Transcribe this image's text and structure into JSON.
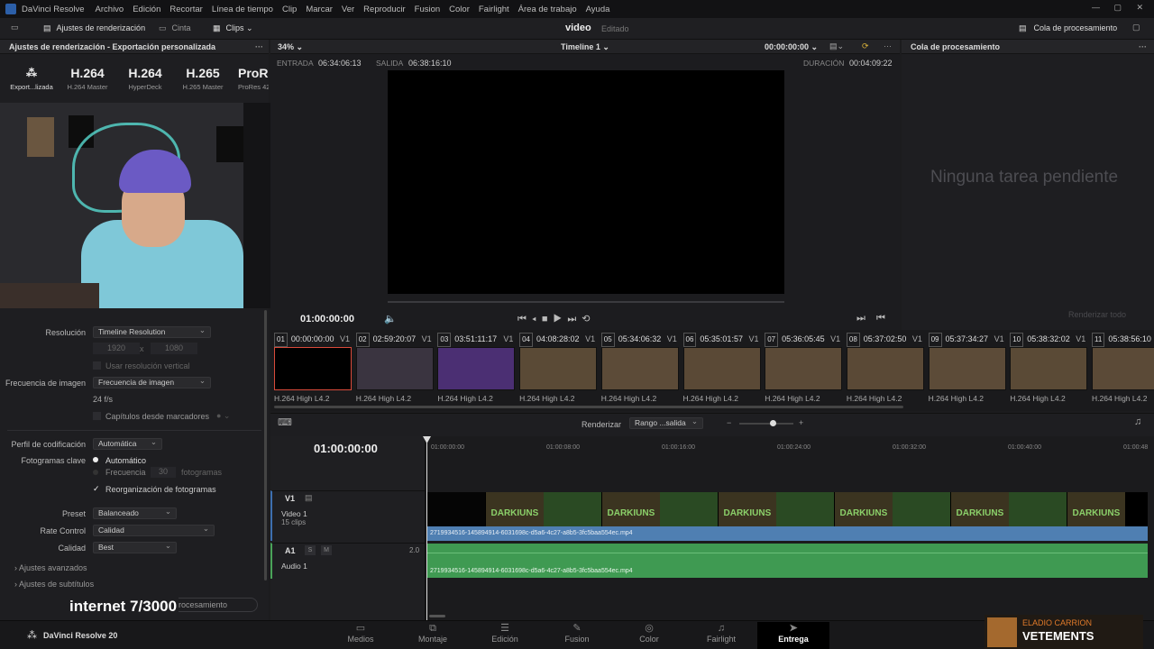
{
  "app": {
    "title": "DaVinci Resolve"
  },
  "menu": [
    "Archivo",
    "Edición",
    "Recortar",
    "Línea de tiempo",
    "Clip",
    "Marcar",
    "Ver",
    "Reproducir",
    "Fusion",
    "Color",
    "Fairlight",
    "Área de trabajo",
    "Ayuda"
  ],
  "toolbar": {
    "render_settings": "Ajustes de renderización",
    "tape": "Cinta",
    "clips": "Clips",
    "project": "video",
    "status": "Editado",
    "queue": "Cola de procesamiento"
  },
  "render_panel": {
    "title": "Ajustes de renderización - Exportación personalizada",
    "presets": [
      {
        "big": "",
        "label": "Export...lizada"
      },
      {
        "big": "H.264",
        "label": "H.264 Master"
      },
      {
        "big": "H.264",
        "label": "HyperDeck"
      },
      {
        "big": "H.265",
        "label": "H.265 Master"
      },
      {
        "big": "ProRe",
        "label": "ProRes 42"
      }
    ],
    "resolution_label": "Resolución",
    "resolution_value": "Timeline Resolution",
    "width": "1920",
    "x": "x",
    "height": "1080",
    "vertical": "Usar resolución vertical",
    "framerate_label": "Frecuencia de imagen",
    "framerate_value": "Frecuencia de imagen",
    "fps": "24 f/s",
    "chapters": "Capítulos desde marcadores",
    "profile_label": "Perfil de codificación",
    "profile_value": "Automática",
    "keyframes_label": "Fotogramas clave",
    "kf_auto": "Automático",
    "kf_freq": "Frecuencia",
    "kf_freq_val": "30",
    "kf_unit": "fotogramas",
    "reorder": "Reorganización de fotogramas",
    "preset_label": "Preset",
    "preset_value": "Balanceado",
    "ratecontrol_label": "Rate Control",
    "ratecontrol_value": "Calidad",
    "quality_label": "Calidad",
    "quality_value": "Best",
    "advanced": "Ajustes avanzados",
    "subtitles": "Ajustes de subtítulos",
    "add_queue": "Añadir a la cola de procesamiento"
  },
  "viewer": {
    "zoom": "34%",
    "timeline_name": "Timeline 1",
    "timecode_top": "00:00:00:00",
    "in_label": "ENTRADA",
    "in_tc": "06:34:06:13",
    "out_label": "SALIDA",
    "out_tc": "06:38:16:10",
    "dur_label": "DURACIÓN",
    "dur_tc": "00:04:09:22",
    "current_tc": "01:00:00:00"
  },
  "queue": {
    "title": "Cola de procesamiento",
    "empty": "Ninguna tarea pendiente",
    "render_all": "Renderizar todo"
  },
  "clips": [
    {
      "n": "01",
      "tc": "00:00:00:00",
      "trk": "V1",
      "codec": "H.264 High L4.2",
      "color": "#000000"
    },
    {
      "n": "02",
      "tc": "02:59:20:07",
      "trk": "V1",
      "codec": "H.264 High L4.2",
      "color": "#3a3440"
    },
    {
      "n": "03",
      "tc": "03:51:11:17",
      "trk": "V1",
      "codec": "H.264 High L4.2",
      "color": "#4b2f73"
    },
    {
      "n": "04",
      "tc": "04:08:28:02",
      "trk": "V1",
      "codec": "H.264 High L4.2",
      "color": "#5a4a36"
    },
    {
      "n": "05",
      "tc": "05:34:06:32",
      "trk": "V1",
      "codec": "H.264 High L4.2",
      "color": "#5c4b38"
    },
    {
      "n": "06",
      "tc": "05:35:01:57",
      "trk": "V1",
      "codec": "H.264 High L4.2",
      "color": "#5a4936"
    },
    {
      "n": "07",
      "tc": "05:36:05:45",
      "trk": "V1",
      "codec": "H.264 High L4.2",
      "color": "#5b4a37"
    },
    {
      "n": "08",
      "tc": "05:37:02:50",
      "trk": "V1",
      "codec": "H.264 High L4.2",
      "color": "#5a4936"
    },
    {
      "n": "09",
      "tc": "05:37:34:27",
      "trk": "V1",
      "codec": "H.264 High L4.2",
      "color": "#5c4b38"
    },
    {
      "n": "10",
      "tc": "05:38:32:02",
      "trk": "V1",
      "codec": "H.264 High L4.2",
      "color": "#5a4a36"
    },
    {
      "n": "11",
      "tc": "05:38:56:10",
      "trk": "V1",
      "codec": "H.264 High L4.2",
      "color": "#5b4a37"
    }
  ],
  "timeline": {
    "render_label": "Renderizar",
    "range": "Rango ...salida",
    "tc": "01:00:00:00",
    "ruler": [
      "01:00:00:00",
      "01:00:08:00",
      "01:00:16:00",
      "01:00:24:00",
      "01:00:32:00",
      "01:00:40:00",
      "01:00:48"
    ],
    "v1": "V1",
    "video_track": "Video 1",
    "clips_count": "15 clips",
    "a1": "A1",
    "s": "S",
    "m": "M",
    "level": "2.0",
    "audio_track": "Audio 1",
    "clip_name": "2719934516-145894914-6031698c-d5a6-4c27-a8b5-3fc5baa554ec.mp4",
    "thumb_text": "DARKIUNS"
  },
  "pages": [
    {
      "icon": "▭",
      "label": "Medios"
    },
    {
      "icon": "⧉",
      "label": "Montaje"
    },
    {
      "icon": "☰",
      "label": "Edición"
    },
    {
      "icon": "✎",
      "label": "Fusion"
    },
    {
      "icon": "◎",
      "label": "Color"
    },
    {
      "icon": "♫",
      "label": "Fairlight"
    },
    {
      "icon": "➤",
      "label": "Entrega"
    }
  ],
  "footer": {
    "version": "DaVinci Resolve 20"
  },
  "overlay": {
    "counter": "internet 7/3000",
    "artist": "ELADIO CARRION",
    "song": "VETEMENTS"
  }
}
